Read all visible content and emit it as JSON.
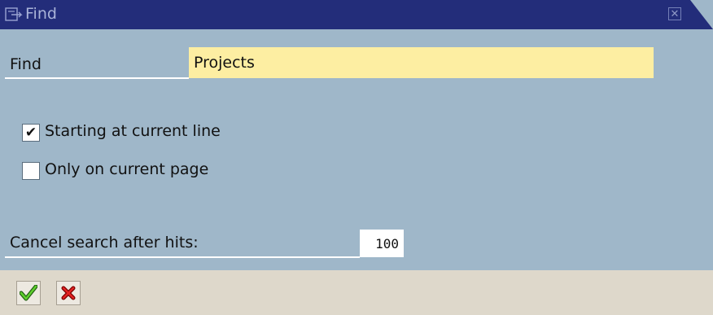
{
  "window": {
    "title": "Find",
    "title_icon": "dialog-icon",
    "close_icon": "close-icon"
  },
  "find": {
    "label": "Find",
    "value": "Projects"
  },
  "options": [
    {
      "label": "Starting at current line",
      "checked": true
    },
    {
      "label": "Only on current page",
      "checked": false
    }
  ],
  "cancel": {
    "label": "Cancel search after hits:",
    "value": "100"
  },
  "toolbar": {
    "confirm_icon": "checkmark-icon",
    "cancel_icon": "cancel-x-icon"
  },
  "colors": {
    "title_bar": "#232d7a",
    "background": "#9fb7c9",
    "input_highlight": "#fdeea2",
    "footer": "#ded8cb",
    "confirm_green": "#3c9a1e",
    "cancel_red": "#cc1111"
  }
}
